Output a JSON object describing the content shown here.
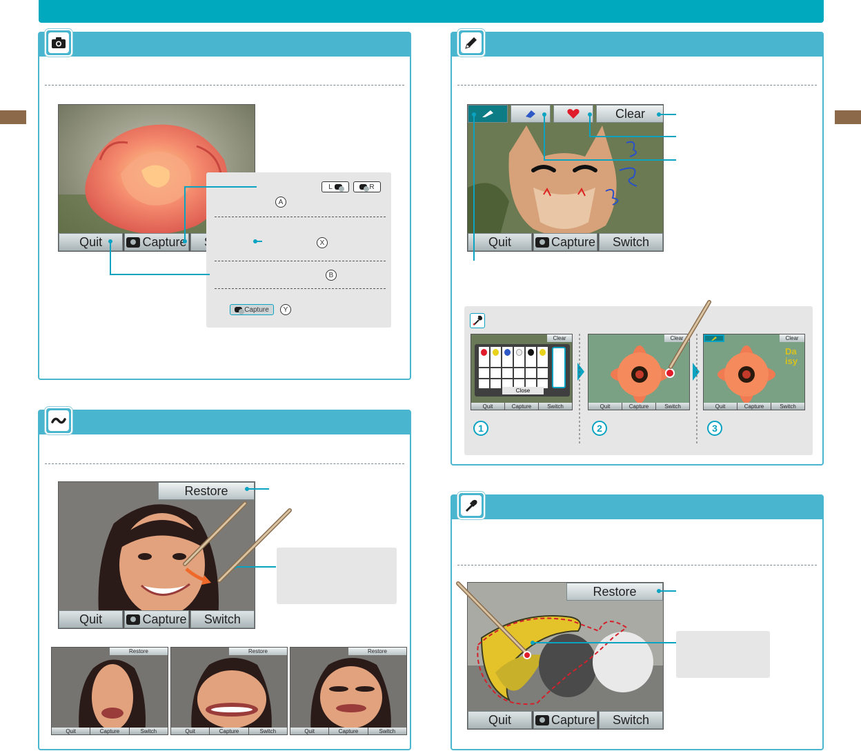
{
  "buttons": {
    "quit": "Quit",
    "capture": "Capture",
    "switch": "Switch",
    "clear": "Clear",
    "restore": "Restore",
    "close": "Close",
    "capture_chip": "Capture"
  },
  "keys": {
    "l": "L",
    "r": "R",
    "a": "A",
    "x": "X",
    "b": "B",
    "y": "Y"
  },
  "daisy_text": "Daisy",
  "steps": [
    "1",
    "2",
    "3"
  ],
  "colors": {
    "header": "#00a9be",
    "panel": "#4ab5cf",
    "accent": "#0aa3c2",
    "tab": "#8c6a49"
  },
  "icons": {
    "camera_section": "camera-icon",
    "pen_section": "pencil-icon",
    "distort_section": "wave-icon",
    "dropper_section": "eyedropper-icon"
  }
}
